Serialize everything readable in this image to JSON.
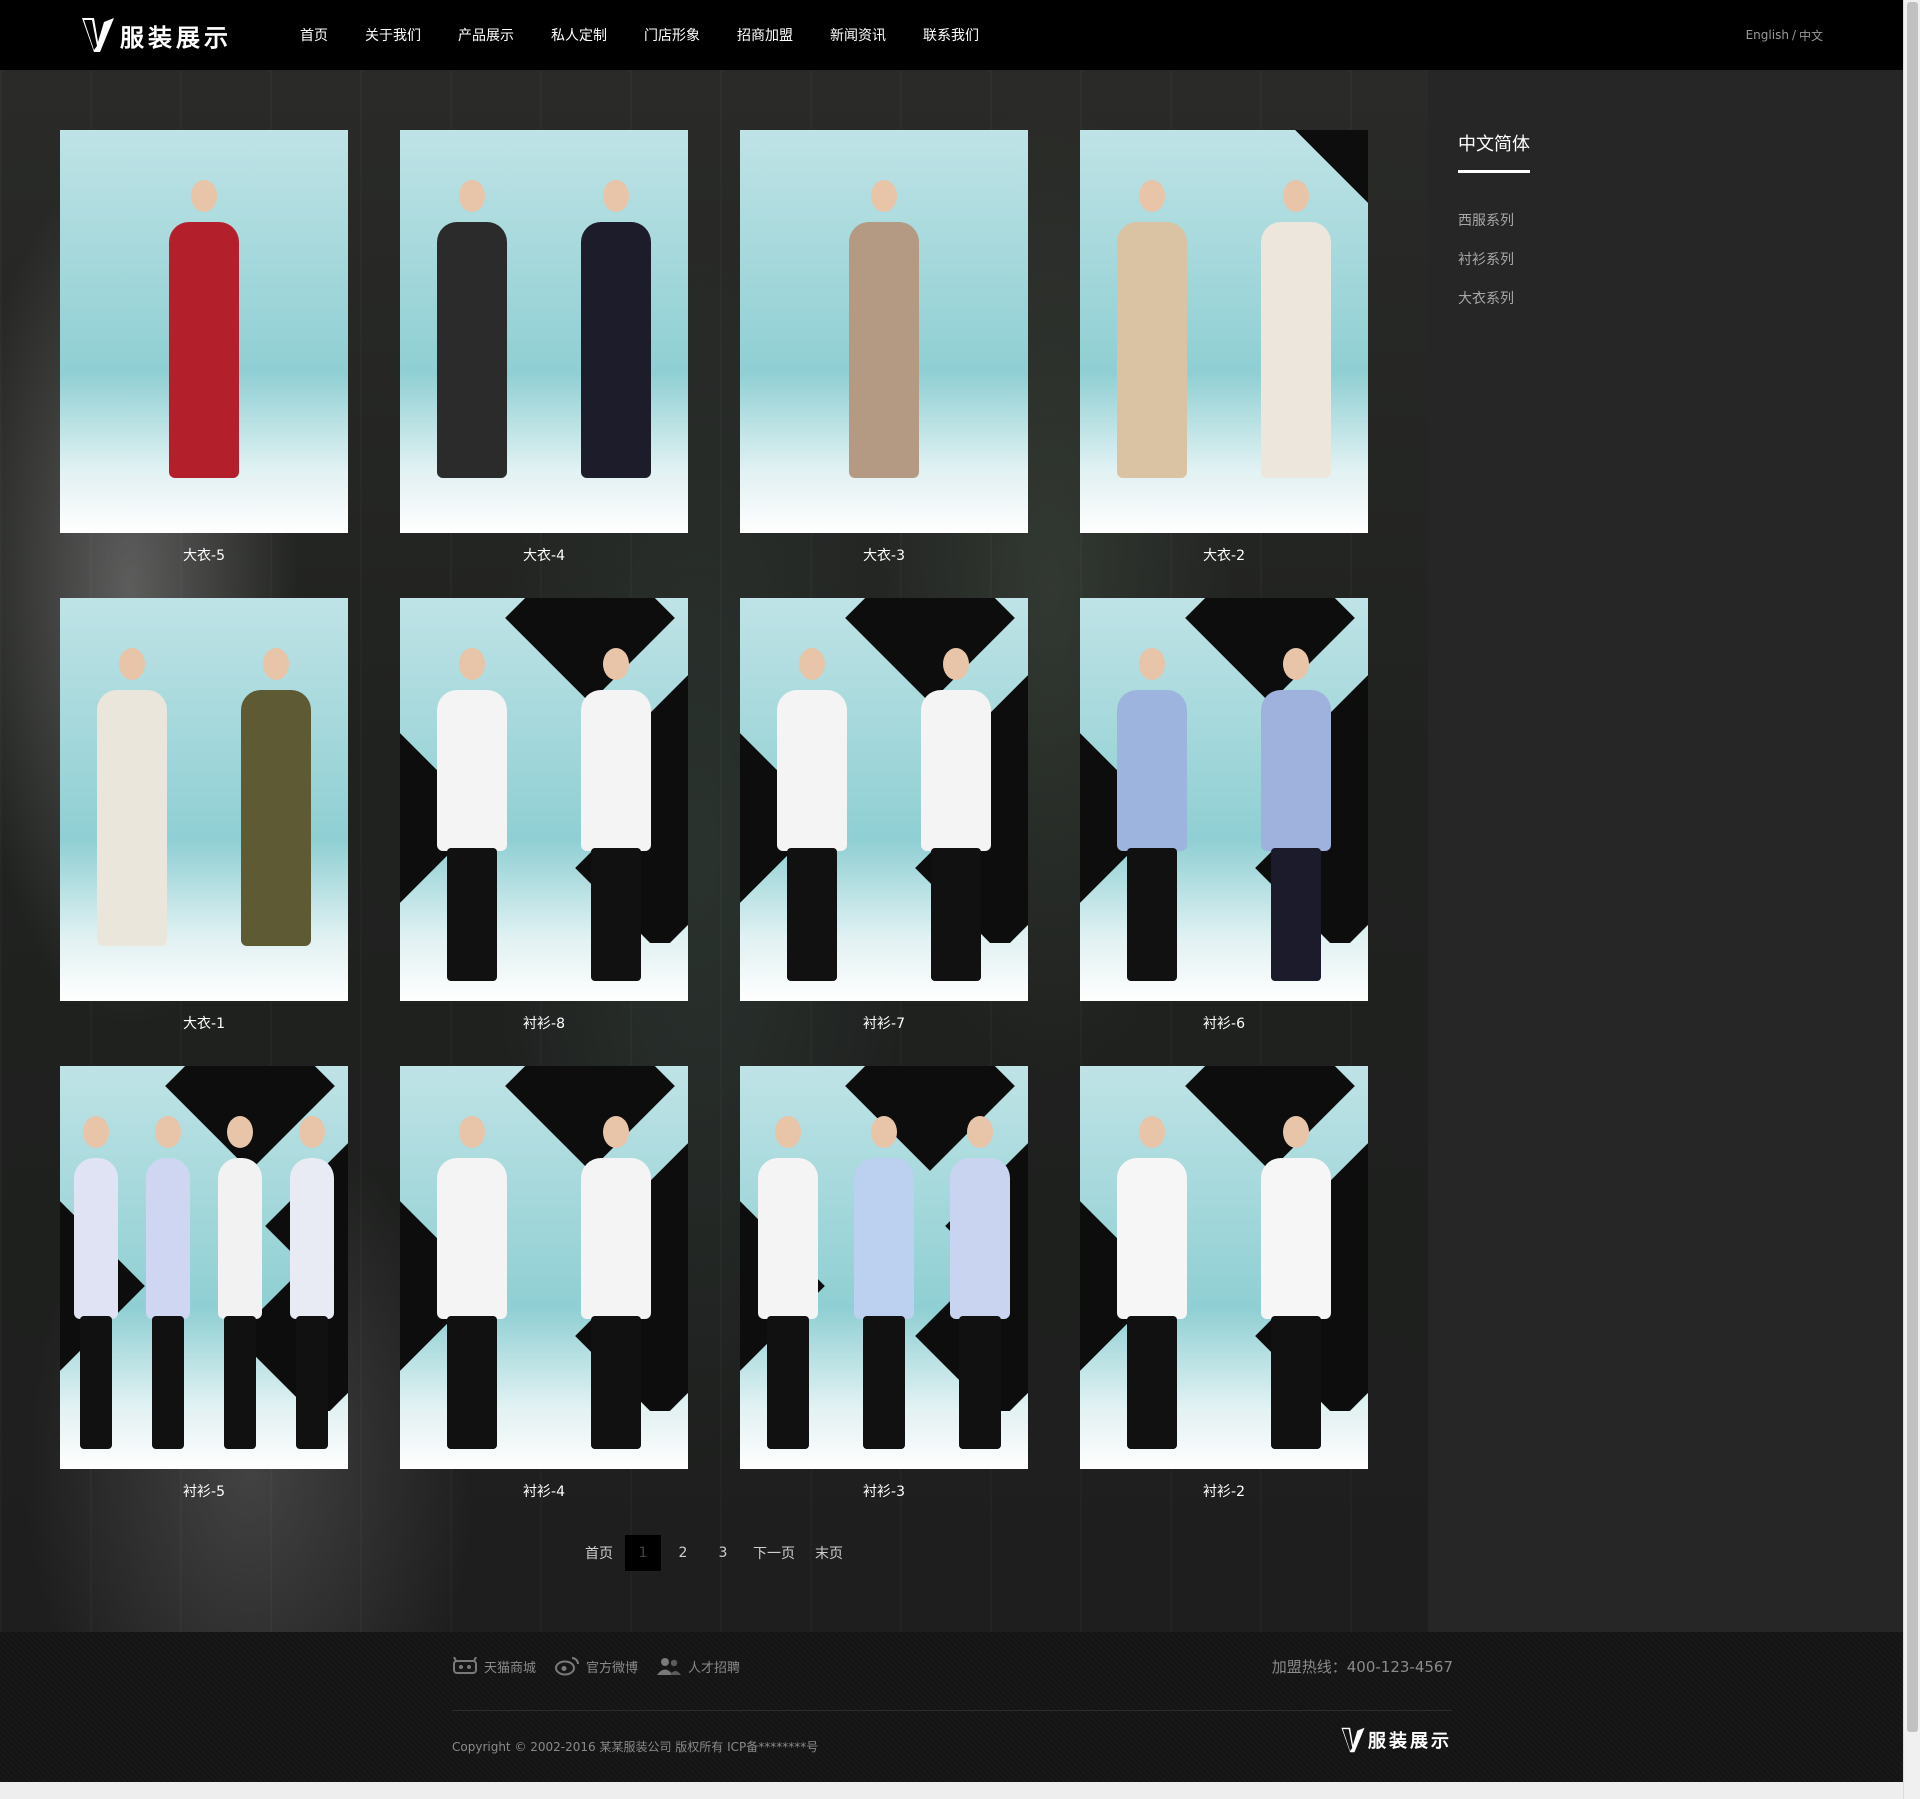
{
  "header": {
    "logo_text": "服装展示",
    "nav": [
      "首页",
      "关于我们",
      "产品展示",
      "私人定制",
      "门店形象",
      "招商加盟",
      "新闻资讯",
      "联系我们"
    ],
    "lang_en": "English",
    "lang_sep": "/",
    "lang_cn": "中文"
  },
  "products": [
    {
      "title": "大衣-5"
    },
    {
      "title": "大衣-4"
    },
    {
      "title": "大衣-3"
    },
    {
      "title": "大衣-2"
    },
    {
      "title": "大衣-1"
    },
    {
      "title": "衬衫-8"
    },
    {
      "title": "衬衫-7"
    },
    {
      "title": "衬衫-6"
    },
    {
      "title": "衬衫-5"
    },
    {
      "title": "衬衫-4"
    },
    {
      "title": "衬衫-3"
    },
    {
      "title": "衬衫-2"
    }
  ],
  "pager": {
    "first": "首页",
    "pages": [
      "1",
      "2",
      "3"
    ],
    "current": "1",
    "next": "下一页",
    "last": "末页"
  },
  "sidebar": {
    "title": "中文简体",
    "items": [
      "西服系列",
      "衬衫系列",
      "大衣系列"
    ]
  },
  "footer": {
    "links": [
      "天猫商城",
      "官方微博",
      "人才招聘"
    ],
    "hotline": "加盟热线：400-123-4567",
    "copyright": "Copyright © 2002-2016 某某服装公司 版权所有   ICP备********号",
    "logo_text": "服装展示"
  },
  "colors": {
    "header_bg": "#000000",
    "sidebar_bg": "#262626",
    "footer_bg": "#141414",
    "photo_bg": "#8fcfd3"
  }
}
